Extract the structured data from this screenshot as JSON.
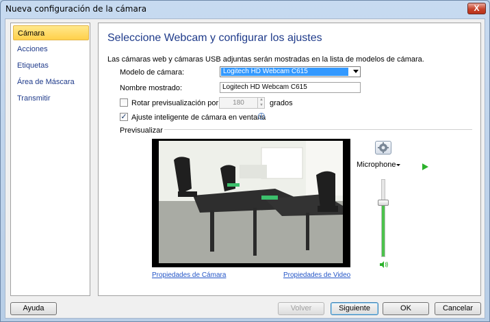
{
  "window": {
    "title": "Nueva configuración de la cámara",
    "close_label": "X"
  },
  "sidebar": {
    "items": [
      {
        "label": "Cámara",
        "active": true
      },
      {
        "label": "Acciones",
        "active": false
      },
      {
        "label": "Etiquetas",
        "active": false
      },
      {
        "label": "Área de Máscara",
        "active": false
      },
      {
        "label": "Transmitir",
        "active": false
      }
    ]
  },
  "main": {
    "heading": "Seleccione Webcam y configurar los ajustes",
    "description": "Las cámaras web y cámaras USB adjuntas serán mostradas en la lista de modelos de cámara.",
    "camera_model": {
      "label": "Modelo de cámara:",
      "value": "Logitech HD Webcam C615"
    },
    "display_name": {
      "label": "Nombre mostrado:",
      "value": "Logitech HD Webcam C615"
    },
    "rotate": {
      "label": "Rotar previsualización por:",
      "checked": false,
      "value": "180",
      "unit": "grados"
    },
    "smart_fit": {
      "label": "Ajuste inteligente de cámara en ventana",
      "checked": true
    },
    "preview_label": "Previsualizar",
    "camera_properties_link": "Propiedades de Cámara",
    "video_properties_link": "Propiedades de Video",
    "microphone": {
      "label": "Microphone",
      "volume": 0.7
    }
  },
  "footer": {
    "help": "Ayuda",
    "back": "Volver",
    "next": "Siguiente",
    "ok": "OK",
    "cancel": "Cancelar"
  },
  "colors": {
    "heading": "#1e3a8a",
    "link": "#2355c7",
    "selection": "#3399ff",
    "active_item": "#ffd04a",
    "play": "#2bb22b",
    "volume": "#4cc24c"
  }
}
